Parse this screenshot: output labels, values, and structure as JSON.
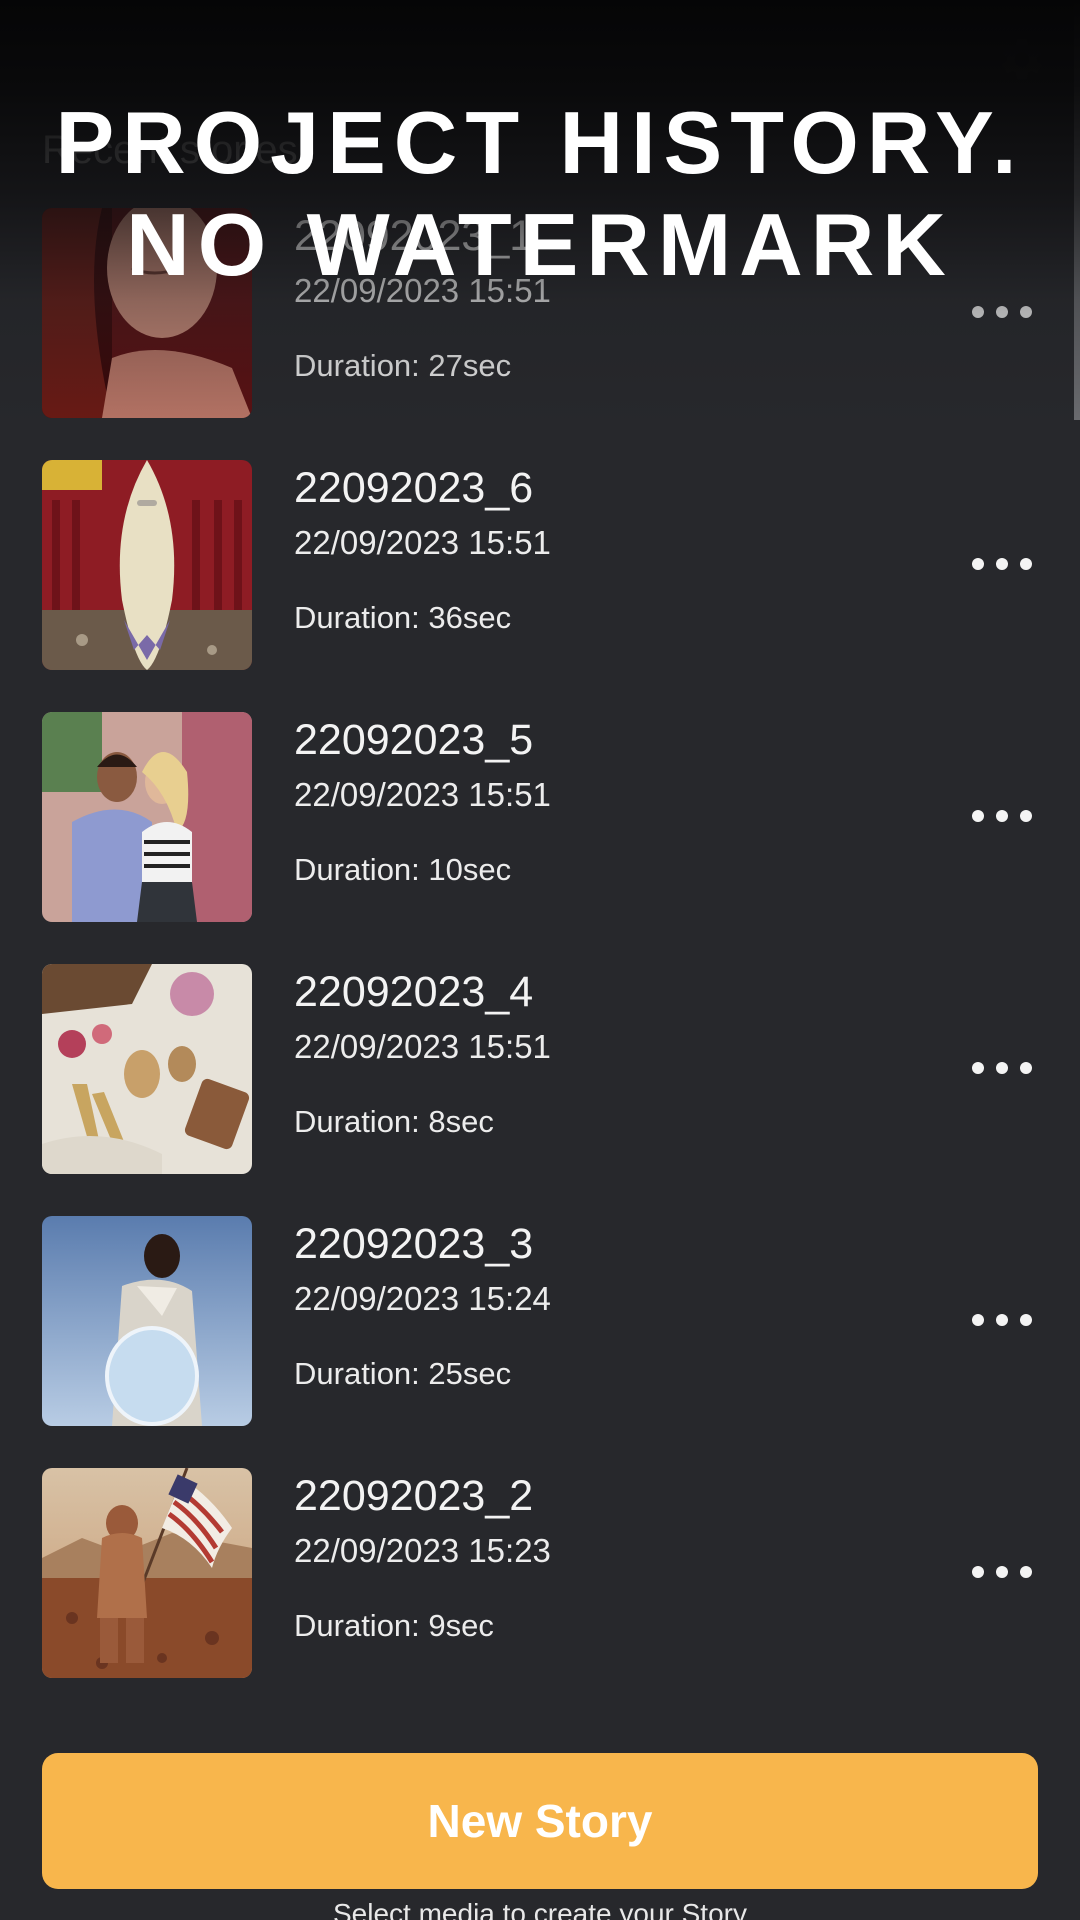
{
  "banner": {
    "line1": "PROJECT HISTORY.",
    "line2": "NO WATERMARK"
  },
  "section": {
    "title": "Recent stories"
  },
  "icons": {
    "settings": "gear-icon",
    "more": "more-horizontal-icon"
  },
  "stories": [
    {
      "name": "22092023_1",
      "date": "22/09/2023 15:51",
      "duration": "Duration: 27sec",
      "thumb": "woman-portrait"
    },
    {
      "name": "22092023_6",
      "date": "22/09/2023 15:51",
      "duration": "Duration: 36sec",
      "thumb": "surfboard"
    },
    {
      "name": "22092023_5",
      "date": "22/09/2023 15:51",
      "duration": "Duration: 10sec",
      "thumb": "couple"
    },
    {
      "name": "22092023_4",
      "date": "22/09/2023 15:51",
      "duration": "Duration: 8sec",
      "thumb": "accessories"
    },
    {
      "name": "22092023_3",
      "date": "22/09/2023 15:24",
      "duration": "Duration: 25sec",
      "thumb": "man-mirror"
    },
    {
      "name": "22092023_2",
      "date": "22/09/2023 15:23",
      "duration": "Duration: 9sec",
      "thumb": "astronaut-flag"
    }
  ],
  "new_story": {
    "label": "New Story",
    "hint": "Select media to create your Story"
  },
  "colors": {
    "background": "#27282c",
    "accent": "#f8b64c",
    "text": "#f2f2f2"
  }
}
